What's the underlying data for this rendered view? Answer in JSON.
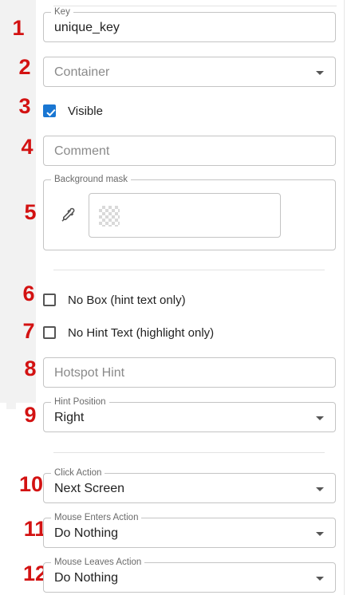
{
  "annotations": [
    "1",
    "2",
    "3",
    "4",
    "5",
    "6",
    "7",
    "8",
    "9",
    "10",
    "11",
    "12"
  ],
  "key_field": {
    "legend": "Key",
    "value": "unique_key"
  },
  "container_field": {
    "placeholder": "Container"
  },
  "visible": {
    "label": "Visible",
    "checked": true
  },
  "comment_field": {
    "placeholder": "Comment"
  },
  "background_mask": {
    "legend": "Background mask"
  },
  "no_box": {
    "label": "No Box (hint text only)",
    "checked": false
  },
  "no_hint_text": {
    "label": "No Hint Text (highlight only)",
    "checked": false
  },
  "hotspot_hint": {
    "placeholder": "Hotspot Hint"
  },
  "hint_position": {
    "legend": "Hint Position",
    "value": "Right"
  },
  "click_action": {
    "legend": "Click Action",
    "value": "Next Screen"
  },
  "mouse_enters_action": {
    "legend": "Mouse Enters Action",
    "value": "Do Nothing"
  },
  "mouse_leaves_action": {
    "legend": "Mouse Leaves Action",
    "value": "Do Nothing"
  },
  "colors": {
    "accent": "#1976d2",
    "annotation": "#d31212",
    "border": "#c4c4c4"
  },
  "icons": {
    "mask_picker": "eyedropper-icon",
    "dropdown": "caret-down-icon"
  }
}
